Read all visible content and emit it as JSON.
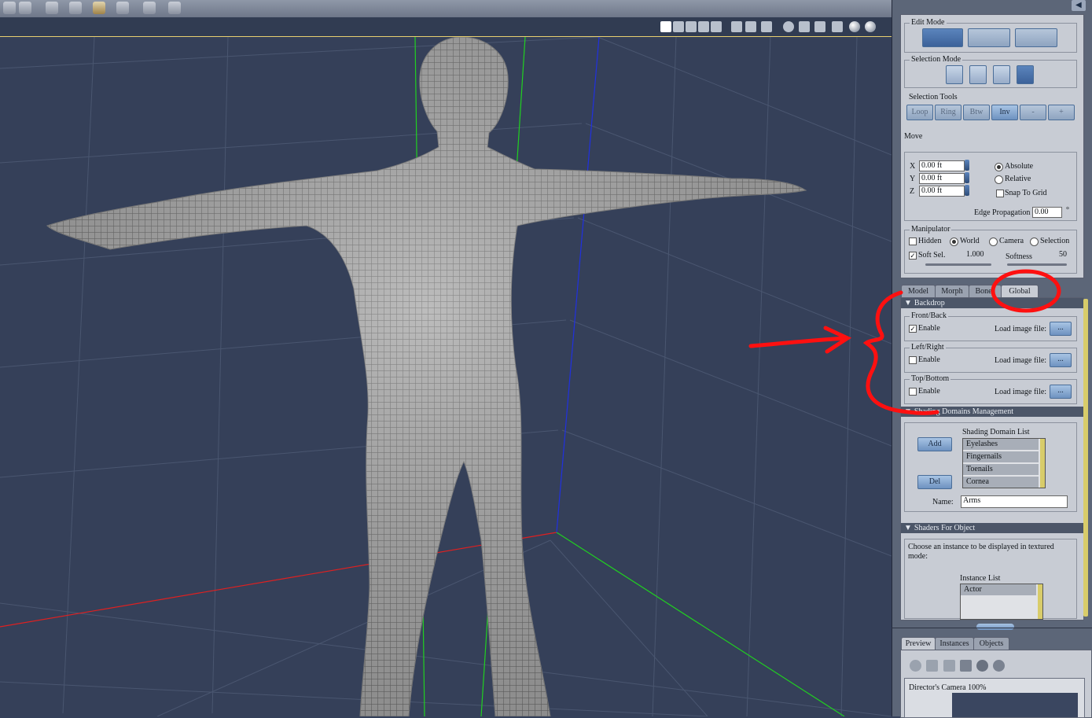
{
  "edit_mode": {
    "title": "Edit Mode"
  },
  "selection_mode": {
    "title": "Selection Mode"
  },
  "selection_tools": {
    "title": "Selection Tools",
    "buttons": [
      "Loop",
      "Ring",
      "Btw",
      "Inv",
      "-",
      "+"
    ]
  },
  "move": {
    "title": "Move",
    "x_label": "X",
    "y_label": "Y",
    "z_label": "Z",
    "x_value": "0.00 ft",
    "y_value": "0.00 ft",
    "z_value": "0.00 ft",
    "absolute": "Absolute",
    "relative": "Relative",
    "snap_to_grid": "Snap To Grid",
    "edge_propagation_label": "Edge Propagation",
    "edge_propagation_value": "0.00",
    "degree": "°"
  },
  "manipulator": {
    "title": "Manipulator",
    "hidden": "Hidden",
    "world": "World",
    "camera": "Camera",
    "selection": "Selection",
    "soft_sel": "Soft Sel.",
    "soft_sel_value": "1.000",
    "softness": "Softness",
    "softness_value": "50"
  },
  "tabs": [
    "Model",
    "Morph",
    "Bones",
    "Global"
  ],
  "backdrop": {
    "title": "Backdrop",
    "groups": [
      {
        "name": "Front/Back",
        "enable": "Enable",
        "load": "Load image file:",
        "button": "...",
        "checked": true
      },
      {
        "name": "Left/Right",
        "enable": "Enable",
        "load": "Load image file:",
        "button": "...",
        "checked": false
      },
      {
        "name": "Top/Bottom",
        "enable": "Enable",
        "load": "Load image file:",
        "button": "...",
        "checked": false
      }
    ]
  },
  "shading_domains": {
    "title": "Shading Domains Management",
    "add": "Add",
    "del": "Del",
    "list_title": "Shading Domain List",
    "items": [
      "Eyelashes",
      "Fingernails",
      "Toenails",
      "Cornea"
    ],
    "name_label": "Name:",
    "name_value": "Arms"
  },
  "shaders": {
    "title": "Shaders For Object",
    "description": "Choose an instance to be displayed in textured mode:",
    "instance_list_title": "Instance List",
    "instances": [
      "Actor"
    ]
  },
  "bottom_tabs": [
    "Preview",
    "Instances",
    "Objects"
  ],
  "preview": {
    "caption": "Director's Camera 100%"
  },
  "colors": {
    "annotation": "#ff1010",
    "axis_x": "#e02020",
    "axis_y": "#20d020",
    "axis_z": "#2030e0"
  }
}
